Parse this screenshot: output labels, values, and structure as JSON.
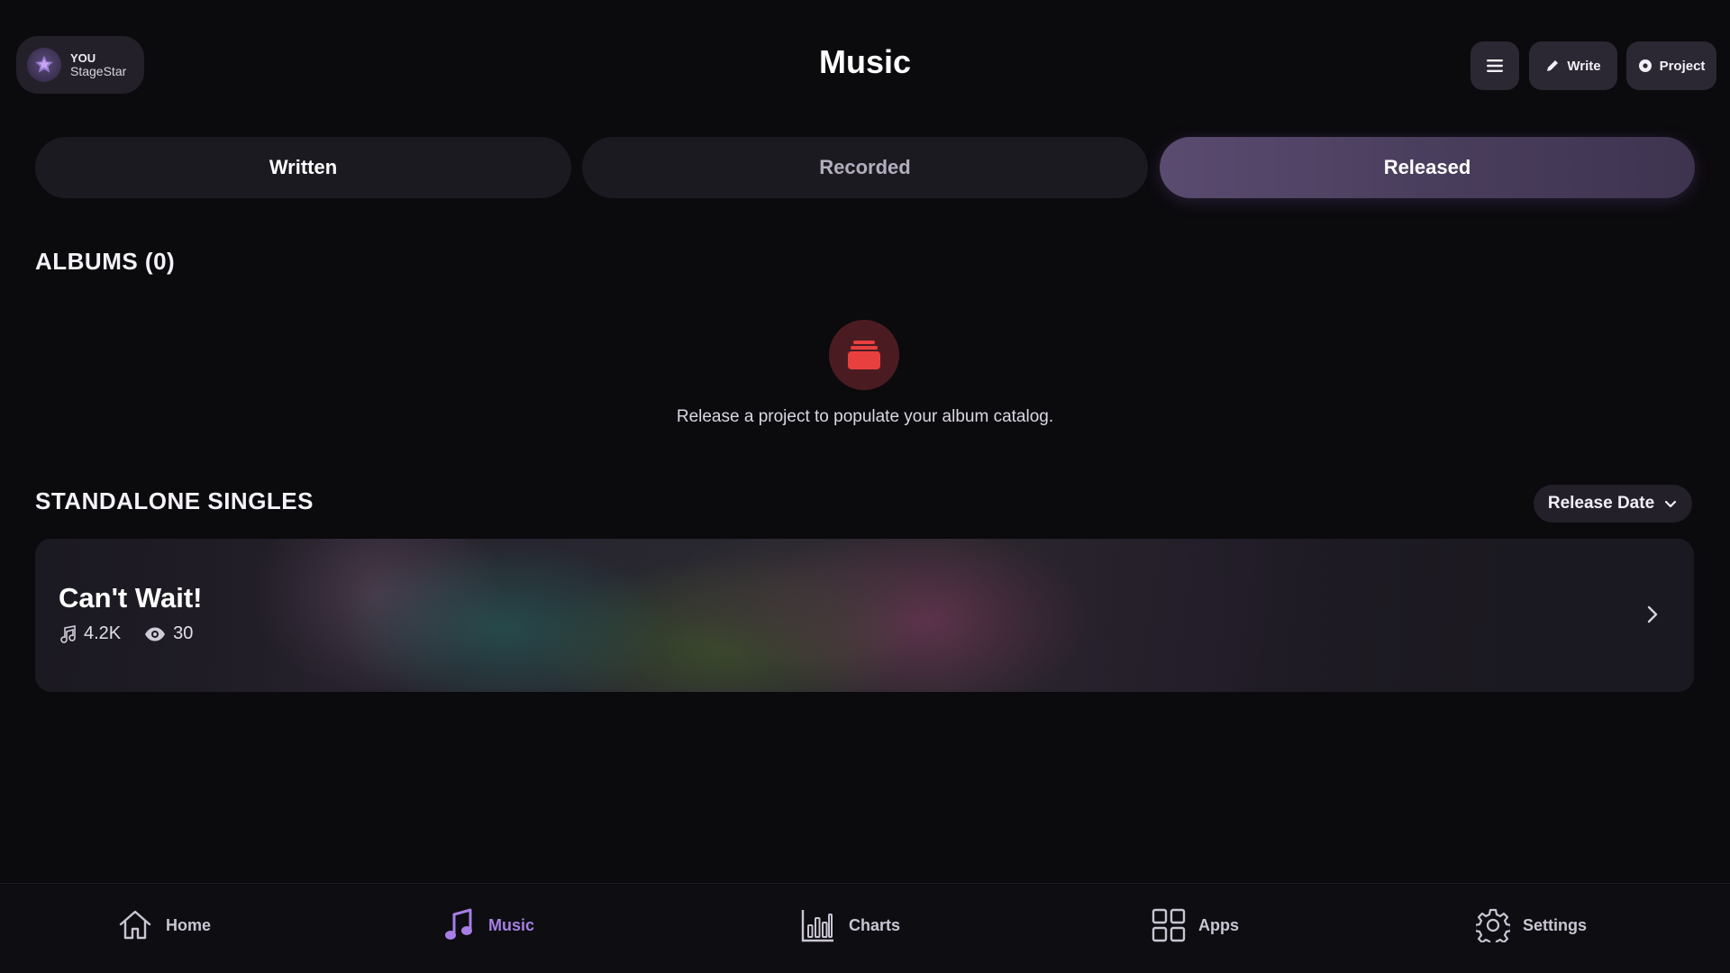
{
  "profile": {
    "role": "YOU",
    "name": "StageStar"
  },
  "header": {
    "title": "Music",
    "write_label": "Write",
    "project_label": "Project"
  },
  "tabs": [
    {
      "label": "Written"
    },
    {
      "label": "Recorded"
    },
    {
      "label": "Released",
      "active": true
    }
  ],
  "albums": {
    "title": "ALBUMS (0)",
    "empty_message": "Release a project to populate your album catalog."
  },
  "singles": {
    "title": "STANDALONE SINGLES",
    "sort_label": "Release Date",
    "items": [
      {
        "title": "Can't Wait!",
        "plays": "4.2K",
        "views": "30"
      }
    ]
  },
  "nav": {
    "items": [
      {
        "label": "Home",
        "icon": "home-icon"
      },
      {
        "label": "Music",
        "icon": "music-note-icon",
        "active": true
      },
      {
        "label": "Charts",
        "icon": "bar-chart-icon"
      },
      {
        "label": "Apps",
        "icon": "grid-icon"
      },
      {
        "label": "Settings",
        "icon": "gear-icon"
      }
    ]
  },
  "colors": {
    "accent": "#a77ee6",
    "background": "#0b0a0d",
    "empty_icon": "#e8403f"
  }
}
